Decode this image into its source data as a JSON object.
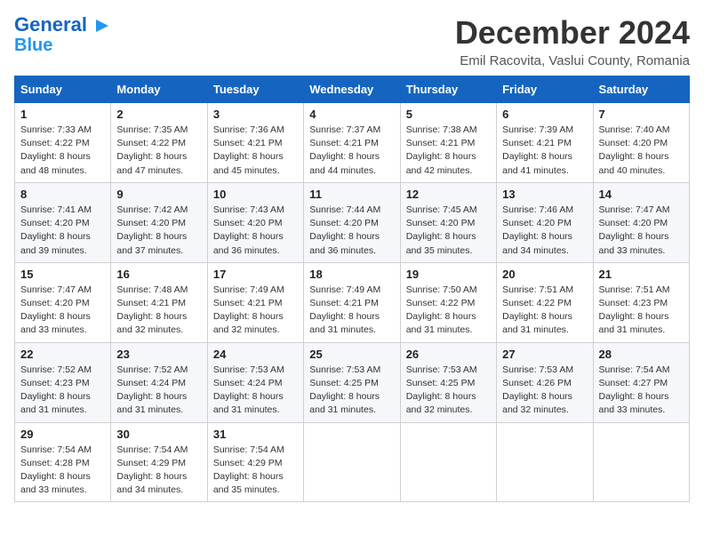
{
  "header": {
    "logo_line1": "General",
    "logo_line2": "Blue",
    "month": "December 2024",
    "location": "Emil Racovita, Vaslui County, Romania"
  },
  "days_of_week": [
    "Sunday",
    "Monday",
    "Tuesday",
    "Wednesday",
    "Thursday",
    "Friday",
    "Saturday"
  ],
  "weeks": [
    [
      {
        "day": "1",
        "info": "Sunrise: 7:33 AM\nSunset: 4:22 PM\nDaylight: 8 hours and 48 minutes."
      },
      {
        "day": "2",
        "info": "Sunrise: 7:35 AM\nSunset: 4:22 PM\nDaylight: 8 hours and 47 minutes."
      },
      {
        "day": "3",
        "info": "Sunrise: 7:36 AM\nSunset: 4:21 PM\nDaylight: 8 hours and 45 minutes."
      },
      {
        "day": "4",
        "info": "Sunrise: 7:37 AM\nSunset: 4:21 PM\nDaylight: 8 hours and 44 minutes."
      },
      {
        "day": "5",
        "info": "Sunrise: 7:38 AM\nSunset: 4:21 PM\nDaylight: 8 hours and 42 minutes."
      },
      {
        "day": "6",
        "info": "Sunrise: 7:39 AM\nSunset: 4:21 PM\nDaylight: 8 hours and 41 minutes."
      },
      {
        "day": "7",
        "info": "Sunrise: 7:40 AM\nSunset: 4:20 PM\nDaylight: 8 hours and 40 minutes."
      }
    ],
    [
      {
        "day": "8",
        "info": "Sunrise: 7:41 AM\nSunset: 4:20 PM\nDaylight: 8 hours and 39 minutes."
      },
      {
        "day": "9",
        "info": "Sunrise: 7:42 AM\nSunset: 4:20 PM\nDaylight: 8 hours and 37 minutes."
      },
      {
        "day": "10",
        "info": "Sunrise: 7:43 AM\nSunset: 4:20 PM\nDaylight: 8 hours and 36 minutes."
      },
      {
        "day": "11",
        "info": "Sunrise: 7:44 AM\nSunset: 4:20 PM\nDaylight: 8 hours and 36 minutes."
      },
      {
        "day": "12",
        "info": "Sunrise: 7:45 AM\nSunset: 4:20 PM\nDaylight: 8 hours and 35 minutes."
      },
      {
        "day": "13",
        "info": "Sunrise: 7:46 AM\nSunset: 4:20 PM\nDaylight: 8 hours and 34 minutes."
      },
      {
        "day": "14",
        "info": "Sunrise: 7:47 AM\nSunset: 4:20 PM\nDaylight: 8 hours and 33 minutes."
      }
    ],
    [
      {
        "day": "15",
        "info": "Sunrise: 7:47 AM\nSunset: 4:20 PM\nDaylight: 8 hours and 33 minutes."
      },
      {
        "day": "16",
        "info": "Sunrise: 7:48 AM\nSunset: 4:21 PM\nDaylight: 8 hours and 32 minutes."
      },
      {
        "day": "17",
        "info": "Sunrise: 7:49 AM\nSunset: 4:21 PM\nDaylight: 8 hours and 32 minutes."
      },
      {
        "day": "18",
        "info": "Sunrise: 7:49 AM\nSunset: 4:21 PM\nDaylight: 8 hours and 31 minutes."
      },
      {
        "day": "19",
        "info": "Sunrise: 7:50 AM\nSunset: 4:22 PM\nDaylight: 8 hours and 31 minutes."
      },
      {
        "day": "20",
        "info": "Sunrise: 7:51 AM\nSunset: 4:22 PM\nDaylight: 8 hours and 31 minutes."
      },
      {
        "day": "21",
        "info": "Sunrise: 7:51 AM\nSunset: 4:23 PM\nDaylight: 8 hours and 31 minutes."
      }
    ],
    [
      {
        "day": "22",
        "info": "Sunrise: 7:52 AM\nSunset: 4:23 PM\nDaylight: 8 hours and 31 minutes."
      },
      {
        "day": "23",
        "info": "Sunrise: 7:52 AM\nSunset: 4:24 PM\nDaylight: 8 hours and 31 minutes."
      },
      {
        "day": "24",
        "info": "Sunrise: 7:53 AM\nSunset: 4:24 PM\nDaylight: 8 hours and 31 minutes."
      },
      {
        "day": "25",
        "info": "Sunrise: 7:53 AM\nSunset: 4:25 PM\nDaylight: 8 hours and 31 minutes."
      },
      {
        "day": "26",
        "info": "Sunrise: 7:53 AM\nSunset: 4:25 PM\nDaylight: 8 hours and 32 minutes."
      },
      {
        "day": "27",
        "info": "Sunrise: 7:53 AM\nSunset: 4:26 PM\nDaylight: 8 hours and 32 minutes."
      },
      {
        "day": "28",
        "info": "Sunrise: 7:54 AM\nSunset: 4:27 PM\nDaylight: 8 hours and 33 minutes."
      }
    ],
    [
      {
        "day": "29",
        "info": "Sunrise: 7:54 AM\nSunset: 4:28 PM\nDaylight: 8 hours and 33 minutes."
      },
      {
        "day": "30",
        "info": "Sunrise: 7:54 AM\nSunset: 4:29 PM\nDaylight: 8 hours and 34 minutes."
      },
      {
        "day": "31",
        "info": "Sunrise: 7:54 AM\nSunset: 4:29 PM\nDaylight: 8 hours and 35 minutes."
      },
      null,
      null,
      null,
      null
    ]
  ]
}
